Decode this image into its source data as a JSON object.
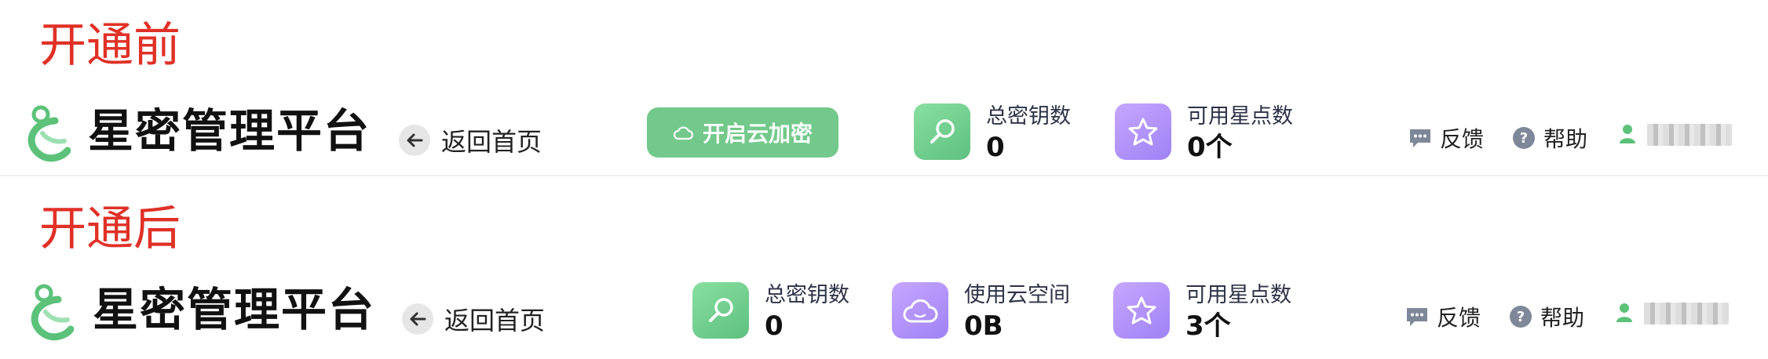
{
  "labels": {
    "before": "开通前",
    "after": "开通后"
  },
  "brand": "星密管理平台",
  "back_label": "返回首页",
  "enable_button": "开启云加密",
  "before": {
    "stats": [
      {
        "icon": "key-search-icon",
        "label": "总密钥数",
        "value": "0"
      },
      {
        "icon": "star-icon",
        "label": "可用星点数",
        "value": "0个"
      }
    ]
  },
  "after": {
    "stats": [
      {
        "icon": "key-search-icon",
        "label": "总密钥数",
        "value": "0"
      },
      {
        "icon": "cloud-icon",
        "label": "使用云空间",
        "value": "0B"
      },
      {
        "icon": "star-icon",
        "label": "可用星点数",
        "value": "3个"
      }
    ]
  },
  "actions": {
    "feedback": "反馈",
    "help": "帮助"
  },
  "colors": {
    "accent_green": "#73c98b",
    "purple": "#a98cf7",
    "label_red": "#e03127"
  }
}
